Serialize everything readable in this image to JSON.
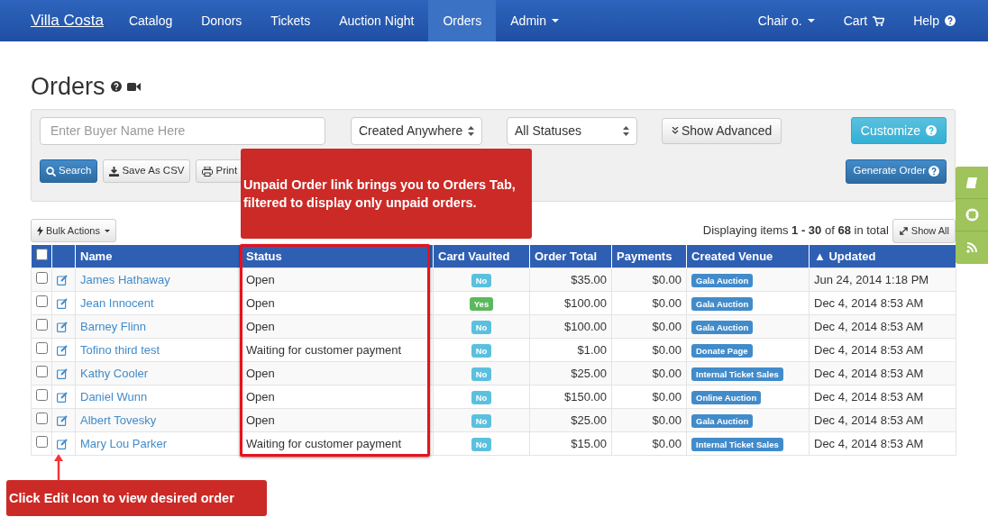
{
  "nav": {
    "brand": "Villa Costa",
    "items": [
      {
        "label": "Catalog",
        "selected": false,
        "dropdown": false
      },
      {
        "label": "Donors",
        "selected": false,
        "dropdown": false
      },
      {
        "label": "Tickets",
        "selected": false,
        "dropdown": false
      },
      {
        "label": "Auction Night",
        "selected": false,
        "dropdown": false
      },
      {
        "label": "Orders",
        "selected": true,
        "dropdown": false
      },
      {
        "label": "Admin",
        "selected": false,
        "dropdown": true
      }
    ],
    "right_items": [
      {
        "label": "Chair o.",
        "kind": "dropdown"
      },
      {
        "label": "Cart",
        "kind": "cart"
      },
      {
        "label": "Help",
        "kind": "help"
      }
    ]
  },
  "page_title": "Orders",
  "filters": {
    "buyer": {
      "placeholder": "Enter Buyer Name Here"
    },
    "venue_select": "Created Anywhere",
    "status_select": "All Statuses",
    "show_advanced": "Show Advanced",
    "customize": "Customize"
  },
  "actions": [
    {
      "label": "Search",
      "kind": "search"
    },
    {
      "label": "Save As CSV",
      "kind": "download"
    },
    {
      "label": "Print",
      "kind": "print"
    }
  ],
  "generate_order": "Generate Order",
  "bulk_actions": "Bulk Actions",
  "pagination": "Displaying items **1 - 30** of **68** in total",
  "show_all": "Show All",
  "table": {
    "select_all": {
      "checked": false
    },
    "columns": [
      "Name",
      "Status",
      "Card Vaulted",
      "Order Total",
      "Payments",
      "Created Venue",
      "▲ Updated"
    ],
    "rows": [
      {
        "checked": false,
        "name": "James Hathaway",
        "status": "Open",
        "vaulted": false,
        "vaulted_label": "No",
        "order_total": "$35.00",
        "payments": "$0.00",
        "venue": "Gala Auction",
        "updated": "Jun 24, 2014 1:18 PM"
      },
      {
        "checked": false,
        "name": "Jean Innocent",
        "status": "Open",
        "vaulted": true,
        "vaulted_label": "Yes",
        "order_total": "$100.00",
        "payments": "$0.00",
        "venue": "Gala Auction",
        "updated": "Dec 4, 2014 8:53 AM"
      },
      {
        "checked": false,
        "name": "Barney Flinn",
        "status": "Open",
        "vaulted": false,
        "vaulted_label": "No",
        "order_total": "$100.00",
        "payments": "$0.00",
        "venue": "Gala Auction",
        "updated": "Dec 4, 2014 8:53 AM"
      },
      {
        "checked": false,
        "name": "Tofino third test",
        "status": "Waiting for customer payment",
        "vaulted": false,
        "vaulted_label": "No",
        "order_total": "$1.00",
        "payments": "$0.00",
        "venue": "Donate Page",
        "updated": "Dec 4, 2014 8:53 AM"
      },
      {
        "checked": false,
        "name": "Kathy Cooler",
        "status": "Open",
        "vaulted": false,
        "vaulted_label": "No",
        "order_total": "$25.00",
        "payments": "$0.00",
        "venue": "Internal Ticket Sales",
        "updated": "Dec 4, 2014 8:53 AM"
      },
      {
        "checked": false,
        "name": "Daniel Wunn",
        "status": "Open",
        "vaulted": false,
        "vaulted_label": "No",
        "order_total": "$150.00",
        "payments": "$0.00",
        "venue": "Online Auction",
        "updated": "Dec 4, 2014 8:53 AM"
      },
      {
        "checked": false,
        "name": "Albert Tovesky",
        "status": "Open",
        "vaulted": false,
        "vaulted_label": "No",
        "order_total": "$25.00",
        "payments": "$0.00",
        "venue": "Gala Auction",
        "updated": "Dec 4, 2014 8:53 AM"
      },
      {
        "checked": false,
        "name": "Mary Lou Parker",
        "status": "Waiting for customer payment",
        "vaulted": false,
        "vaulted_label": "No",
        "order_total": "$15.00",
        "payments": "$0.00",
        "venue": "Internal Ticket Sales",
        "updated": "Dec 4, 2014 8:53 AM"
      }
    ]
  },
  "callouts": [
    {
      "kind": "status",
      "text": "Unpaid Order link brings you to Orders Tab, filtered to display only unpaid orders."
    },
    {
      "kind": "edit",
      "text": "Click Edit Icon to view desired order"
    }
  ]
}
